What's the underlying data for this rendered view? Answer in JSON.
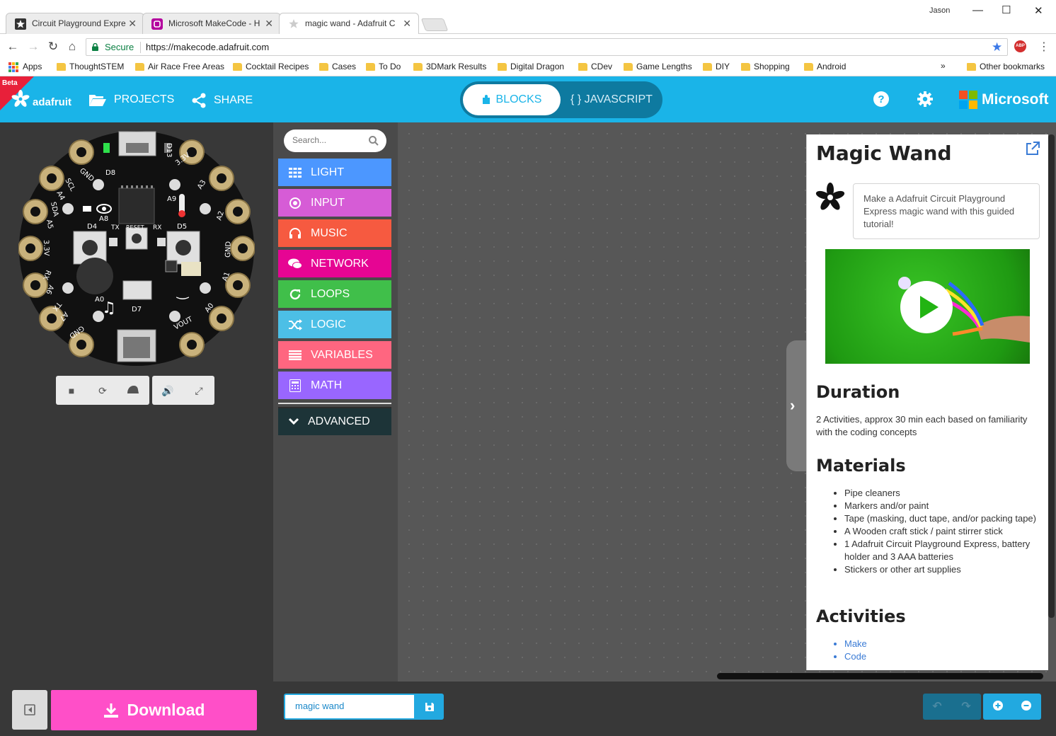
{
  "browser": {
    "user": "Jason",
    "tabs": [
      {
        "title": "Circuit Playground Expre",
        "active": false
      },
      {
        "title": "Microsoft MakeCode - H",
        "active": false
      },
      {
        "title": "magic wand - Adafruit C",
        "active": true
      }
    ],
    "secure_label": "Secure",
    "url": "https://makecode.adafruit.com",
    "bookmarks": [
      "Apps",
      "ThoughtSTEM",
      "Air Race Free Areas",
      "Cocktail Recipes",
      "Cases",
      "To Do",
      "3DMark Results",
      "Digital Dragon",
      "CDev",
      "Game Lengths",
      "DIY",
      "Shopping",
      "Android"
    ],
    "overflow": "»",
    "other_bookmarks": "Other bookmarks"
  },
  "header": {
    "beta": "Beta",
    "brand": "adafruit",
    "projects": "PROJECTS",
    "share": "SHARE",
    "blocks": "BLOCKS",
    "javascript": "{ } JAVASCRIPT",
    "microsoft": "Microsoft"
  },
  "simulator": {
    "pin_labels": {
      "gnd_top": "GND",
      "scl": "SCL",
      "a4": "A4",
      "sda": "SDA",
      "a5": "A5",
      "v33_left": "3.3V",
      "rx": "RX",
      "a6": "A6",
      "tx": "TX",
      "a7": "A7",
      "gnd_bottom": "GND",
      "d13": "D13",
      "v33_right": "3.3V",
      "a3": "A3",
      "a2": "A2",
      "gnd_right": "GND",
      "a1": "A1",
      "a0_pad": "A0",
      "vout": "VOUT",
      "d8": "D8",
      "a9": "A9",
      "a8": "A8",
      "d4": "D4",
      "d5": "D5",
      "tx_mid": "TX",
      "reset": "RESET",
      "rx_mid": "RX",
      "d7": "D7",
      "a0_mid": "A0"
    }
  },
  "toolbox": {
    "search_placeholder": "Search...",
    "categories": [
      {
        "label": "LIGHT",
        "color": "#4c97ff",
        "icon": "grid-icon"
      },
      {
        "label": "INPUT",
        "color": "#d65cd6",
        "icon": "target-icon"
      },
      {
        "label": "MUSIC",
        "color": "#f65a40",
        "icon": "headphones-icon"
      },
      {
        "label": "NETWORK",
        "color": "#e60593",
        "icon": "chat-icon"
      },
      {
        "label": "LOOPS",
        "color": "#40bf4a",
        "icon": "refresh-icon"
      },
      {
        "label": "LOGIC",
        "color": "#4cbfe6",
        "icon": "shuffle-icon"
      },
      {
        "label": "VARIABLES",
        "color": "#ff6680",
        "icon": "list-icon"
      },
      {
        "label": "MATH",
        "color": "#9966ff",
        "icon": "calculator-icon"
      }
    ],
    "advanced": "ADVANCED"
  },
  "tutorial": {
    "title": "Magic Wand",
    "intro": "Make a Adafruit Circuit Playground Express magic wand with this guided tutorial!",
    "duration_heading": "Duration",
    "duration_text": "2 Activities, approx 30 min each based on familiarity with the coding concepts",
    "materials_heading": "Materials",
    "materials": [
      "Pipe cleaners",
      "Markers and/or paint",
      "Tape (masking, duct tape, and/or packing tape)",
      "A Wooden craft stick / paint stirrer stick",
      "1 Adafruit Circuit Playground Express, battery holder and 3 AAA batteries",
      "Stickers or other art supplies"
    ],
    "activities_heading": "Activities",
    "activities": [
      "Make",
      "Code"
    ]
  },
  "footer": {
    "download": "Download",
    "project_name": "magic wand"
  },
  "colors": {
    "header": "#1ab4e8",
    "download": "#ff4fc8",
    "workspace": "#575757",
    "simulator_bg": "#383838"
  }
}
